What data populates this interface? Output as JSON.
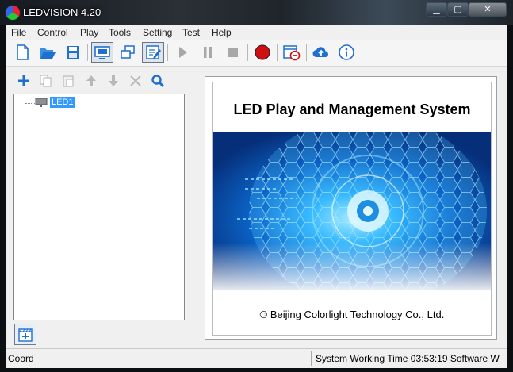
{
  "window": {
    "title": "LEDVISION 4.20",
    "min_symbol": "▁",
    "max_symbol": "▢",
    "close_symbol": "✕"
  },
  "menu": {
    "items": [
      "File",
      "Control",
      "Play",
      "Tools",
      "Setting",
      "Test",
      "Help"
    ]
  },
  "toolbar": {
    "icons": [
      "new-file-icon",
      "open-folder-icon",
      "save-icon",
      "screen-mode-icon",
      "multi-screen-icon",
      "edit-program-icon",
      "play-icon",
      "pause-icon",
      "stop-icon",
      "record-icon",
      "schedule-remove-icon",
      "cloud-upload-icon",
      "info-icon"
    ],
    "pressed": [
      "screen-mode-icon",
      "edit-program-icon"
    ],
    "disabled": [
      "play-icon",
      "pause-icon",
      "stop-icon"
    ]
  },
  "tree_toolbar": {
    "icons": [
      "add-icon",
      "copy-icon",
      "paste-icon",
      "move-up-icon",
      "move-down-icon",
      "delete-icon",
      "search-icon"
    ]
  },
  "tree": {
    "items": [
      {
        "label": "LED1",
        "selected": true
      }
    ]
  },
  "splash": {
    "title": "LED Play and Management System",
    "copyright": "© Beijing Colorlight Technology Co., Ltd."
  },
  "status": {
    "left": "Coord",
    "right": "System Working Time 03:53:19 Software W"
  },
  "colors": {
    "accent_blue": "#1e6fd0",
    "record_red": "#d01010",
    "selection": "#3399ff"
  }
}
